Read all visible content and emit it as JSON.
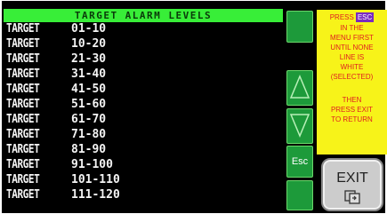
{
  "header": {
    "title": "TARGET ALARM LEVELS"
  },
  "targets": [
    {
      "label": "TARGET",
      "range": "01-10"
    },
    {
      "label": "TARGET",
      "range": "10-20"
    },
    {
      "label": "TARGET",
      "range": "21-30"
    },
    {
      "label": "TARGET",
      "range": "31-40"
    },
    {
      "label": "TARGET",
      "range": "41-50"
    },
    {
      "label": "TARGET",
      "range": "51-60"
    },
    {
      "label": "TARGET",
      "range": "61-70"
    },
    {
      "label": "TARGET",
      "range": "71-80"
    },
    {
      "label": "TARGET",
      "range": "81-90"
    },
    {
      "label": "TARGET",
      "range": "91-100"
    },
    {
      "label": "TARGET",
      "range": "101-110"
    },
    {
      "label": "TARGET",
      "range": "111-120"
    }
  ],
  "nav": {
    "esc_label": "Esc"
  },
  "help": {
    "press": "PRESS",
    "esc_chip": "ESC",
    "lines": [
      "IN THE",
      "MENU FIRST",
      "UNTIL NONE",
      "LINE IS",
      "WHITE",
      "(SELECTED)"
    ],
    "lines2": [
      "THEN",
      "PRESS EXIT",
      "TO RETURN"
    ]
  },
  "exit": {
    "label": "EXIT"
  },
  "colors": {
    "header": "#38ee38",
    "nav": "#1d9a3a",
    "help_bg": "#f7f319",
    "help_text": "#e02020",
    "chip": "#7a2ac0"
  }
}
